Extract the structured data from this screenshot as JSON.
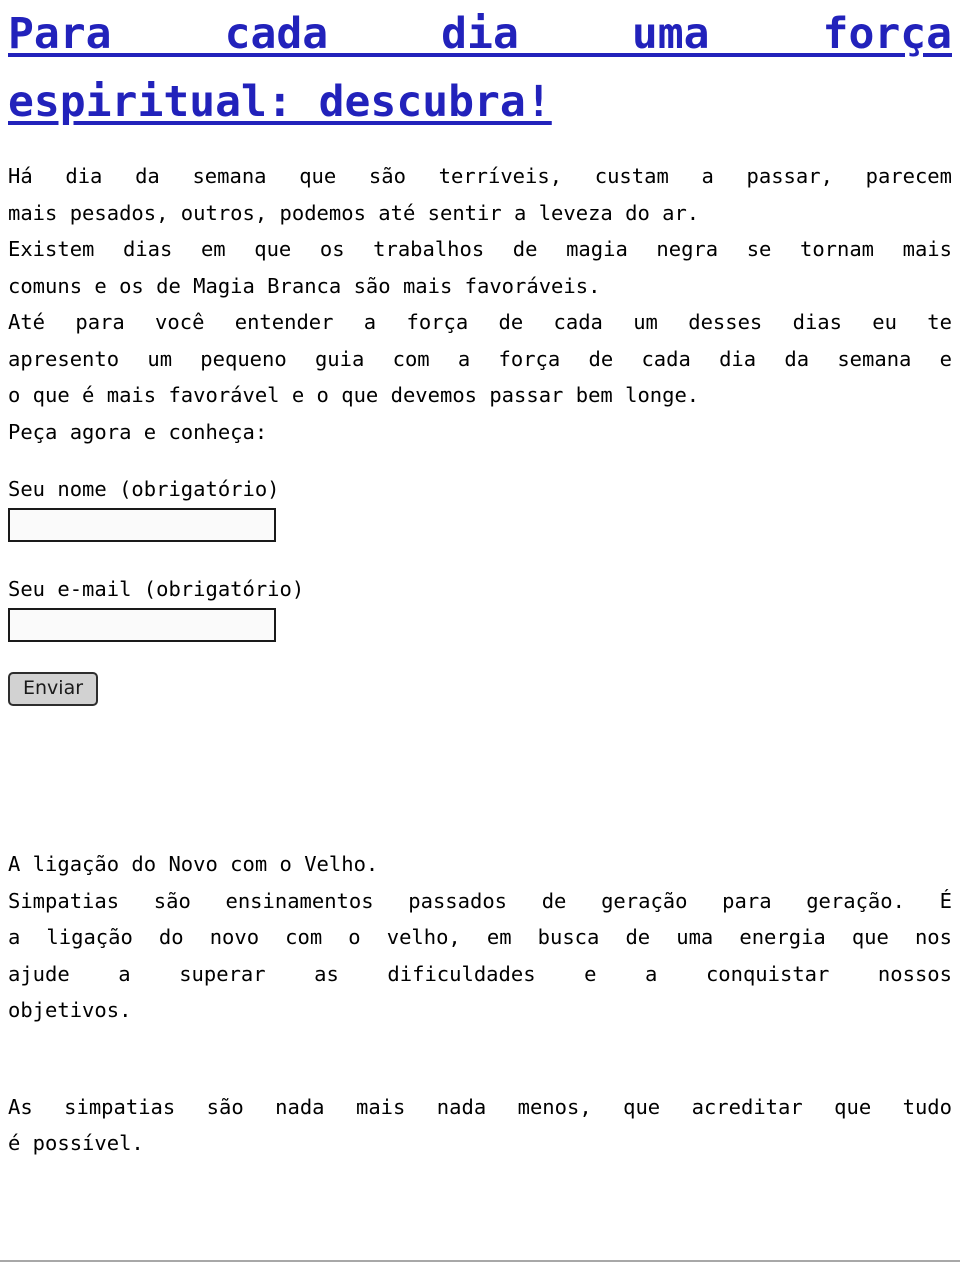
{
  "page": {
    "title_line_1": "Para cada dia uma força",
    "title_line_2": "espiritual: descubra!",
    "title_color": "#2222bb",
    "background_color": "#ffffff",
    "text_color": "#000000"
  },
  "intro": {
    "p1": {
      "line_1": "Há dia da semana que são terríveis, custam a passar, parecem",
      "line_2": "mais pesados, outros, podemos até sentir a leveza do ar."
    },
    "p2": {
      "line_1": "Existem dias em que os trabalhos de magia negra se tornam mais",
      "line_2": "comuns e os de Magia Branca são mais favoráveis."
    },
    "p3": {
      "line_1": "Até para você entender a força de cada um desses dias eu te",
      "line_2": "apresento um pequeno guia com a força de cada dia da semana e",
      "line_3": "o que é mais favorável e o que devemos passar bem longe."
    },
    "cta": "Peça agora e conheça:"
  },
  "form": {
    "name_label": "Seu nome (obrigatório)",
    "name_value": "",
    "name_placeholder": "",
    "email_label": "Seu e-mail (obrigatório)",
    "email_value": "",
    "email_placeholder": "",
    "submit_label": "Enviar",
    "submit_background": "#d2d2d2",
    "input_background": "#fafafa",
    "input_border_color": "#1a1a1a"
  },
  "closing": {
    "p1": {
      "line_1": "A ligação do Novo com o Velho."
    },
    "p2": {
      "line_1": "Simpatias são ensinamentos passados de geração para geração. É",
      "line_2": "a ligação do novo com o velho, em busca de uma energia que nos",
      "line_3": "ajude a superar as dificuldades e a conquistar nossos",
      "line_4": "objetivos."
    },
    "p3": {
      "line_1": "As simpatias são nada mais nada menos, que acreditar que tudo",
      "line_2": "é possível."
    }
  },
  "footer": {
    "rule_color": "#a8a8a8"
  }
}
